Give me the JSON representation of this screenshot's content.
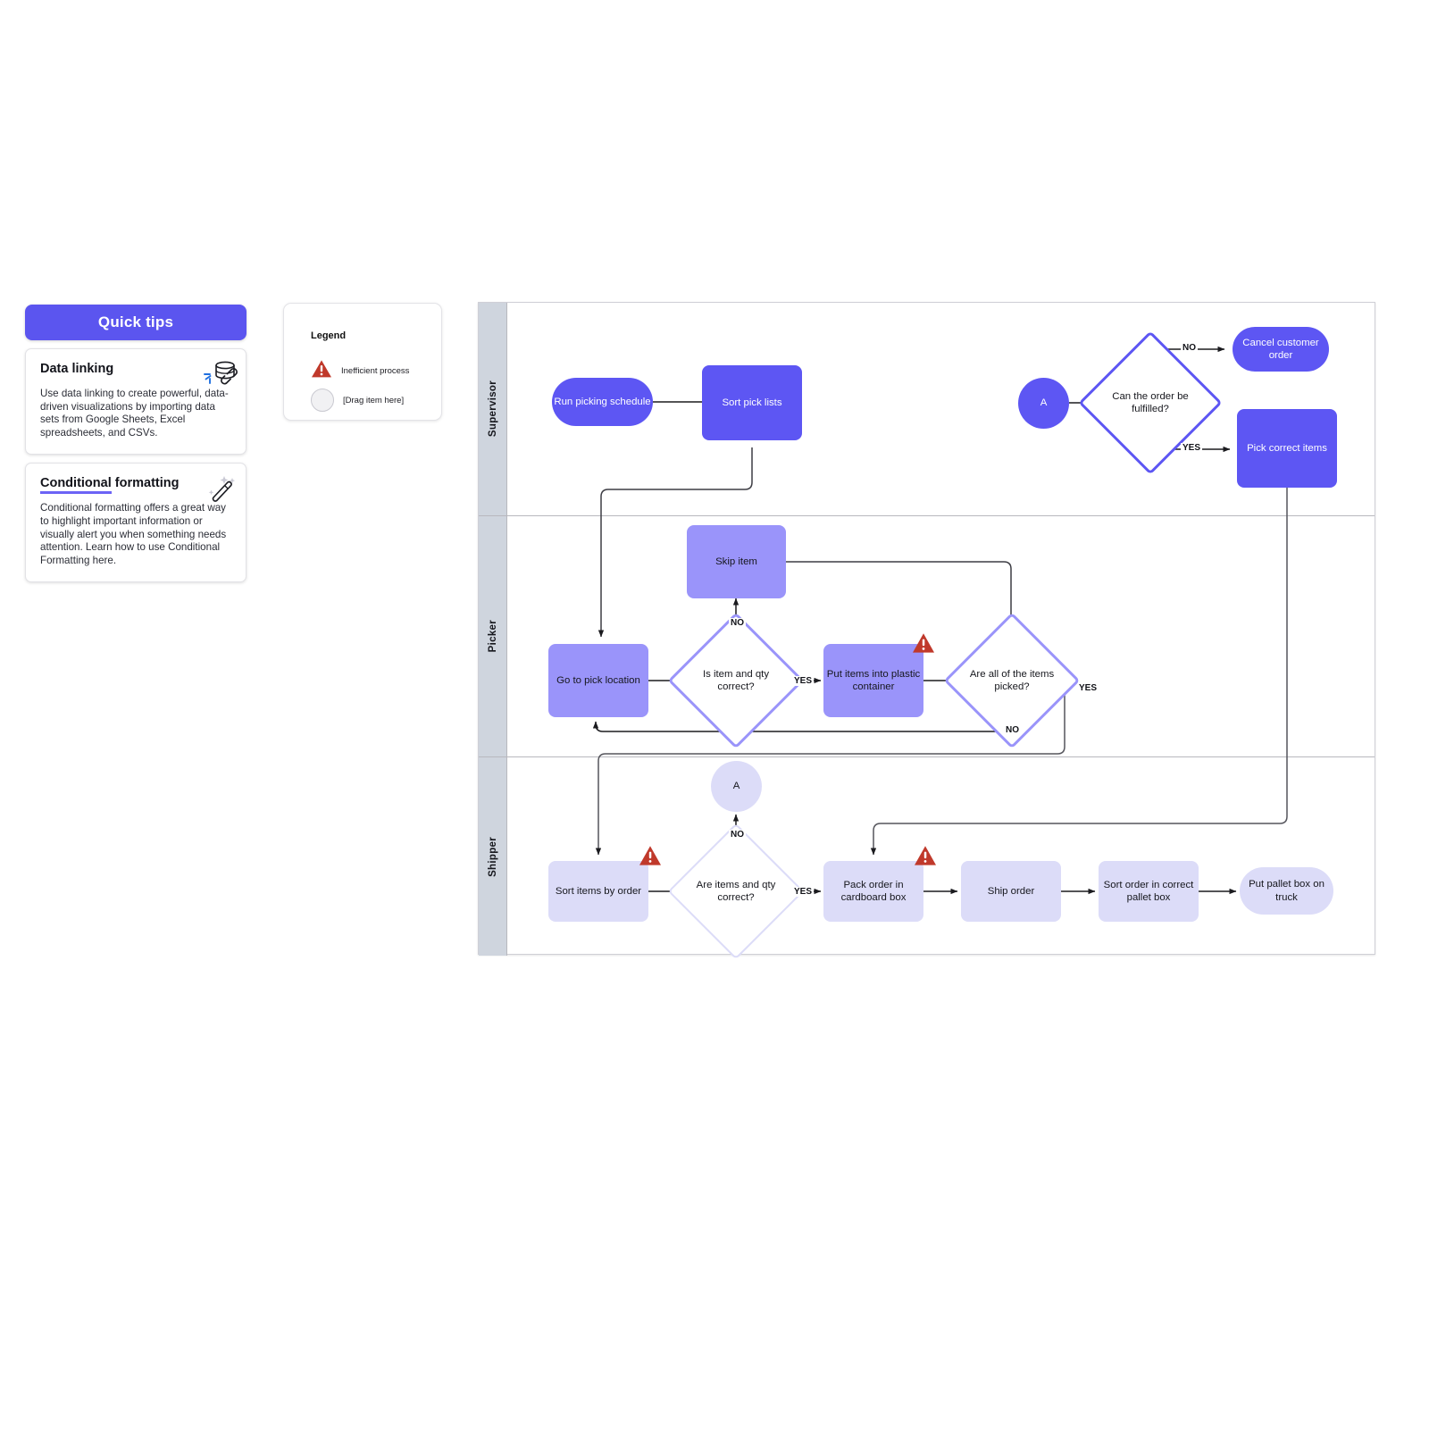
{
  "quick_tips": {
    "header": "Quick tips",
    "cards": [
      {
        "title": "Data linking",
        "title_underline": false,
        "underline_word": "",
        "body": "Use data linking to create powerful, data-driven visualizations by importing data sets from Google Sheets, Excel spreadsheets, and CSVs.",
        "icon": "database-link-icon"
      },
      {
        "title": "Conditional formatting",
        "title_underline": true,
        "underline_word": "Conditional",
        "rest_word": " formatting",
        "body": "Conditional formatting offers a great way to highlight important information or visually alert you when something needs attention. Learn how to use Conditional Formatting here.",
        "icon": "magic-wand-icon"
      }
    ]
  },
  "legend": {
    "title": "Legend",
    "items": [
      {
        "icon": "warning-triangle-icon",
        "label": "Inefficient process"
      },
      {
        "icon": "drop-circle-icon",
        "label": "[Drag item here]"
      }
    ]
  },
  "colors": {
    "supervisor_fill": "#5d56f3",
    "picker_fill": "#9a94fa",
    "shipper_fill": "#dcdcf8",
    "lane_header": "#cfd5de",
    "warning_red": "#c0392b",
    "accent": "#5b55ef"
  },
  "diagram": {
    "type": "swimlane-flowchart",
    "lanes": [
      {
        "id": "supervisor",
        "label": "Supervisor"
      },
      {
        "id": "picker",
        "label": "Picker"
      },
      {
        "id": "shipper",
        "label": "Shipper"
      }
    ],
    "nodes": [
      {
        "id": "run_picking_schedule",
        "lane": "supervisor",
        "shape": "pill",
        "label": "Run picking schedule"
      },
      {
        "id": "sort_pick_lists",
        "lane": "supervisor",
        "shape": "rect",
        "label": "Sort pick lists"
      },
      {
        "id": "connector_a_sup",
        "lane": "supervisor",
        "shape": "circle",
        "label": "A"
      },
      {
        "id": "can_order_be_fulfilled",
        "lane": "supervisor",
        "shape": "diamond",
        "label": "Can the order be fulfilled?"
      },
      {
        "id": "cancel_customer_order",
        "lane": "supervisor",
        "shape": "pill",
        "label": "Cancel customer order"
      },
      {
        "id": "pick_correct_items",
        "lane": "supervisor",
        "shape": "rect",
        "label": "Pick correct items"
      },
      {
        "id": "skip_item",
        "lane": "picker",
        "shape": "rect",
        "label": "Skip item"
      },
      {
        "id": "go_to_pick_location",
        "lane": "picker",
        "shape": "rect",
        "label": "Go to pick location"
      },
      {
        "id": "is_item_and_qty_correct",
        "lane": "picker",
        "shape": "diamond",
        "label": "Is item and qty correct?"
      },
      {
        "id": "put_items_into_plastic_container",
        "lane": "picker",
        "shape": "rect",
        "label": "Put items into plastic container",
        "warning": true
      },
      {
        "id": "are_all_items_picked",
        "lane": "picker",
        "shape": "diamond",
        "label": "Are all of the items picked?"
      },
      {
        "id": "connector_a_ship",
        "lane": "shipper",
        "shape": "circle",
        "label": "A"
      },
      {
        "id": "sort_items_by_order",
        "lane": "shipper",
        "shape": "rect",
        "label": "Sort items by order",
        "warning": true
      },
      {
        "id": "are_items_and_qty_correct",
        "lane": "shipper",
        "shape": "diamond",
        "label": "Are items and qty correct?"
      },
      {
        "id": "pack_order_in_cardboard_box",
        "lane": "shipper",
        "shape": "rect",
        "label": "Pack order in cardboard box",
        "warning": true
      },
      {
        "id": "ship_order",
        "lane": "shipper",
        "shape": "rect",
        "label": "Ship order"
      },
      {
        "id": "sort_order_pallet_box",
        "lane": "shipper",
        "shape": "rect",
        "label": "Sort order in correct pallet box"
      },
      {
        "id": "put_pallet_box_on_truck",
        "lane": "shipper",
        "shape": "pill",
        "label": "Put pallet box on truck"
      }
    ],
    "edges": [
      {
        "from": "run_picking_schedule",
        "to": "sort_pick_lists",
        "label": ""
      },
      {
        "from": "sort_pick_lists",
        "to": "go_to_pick_location",
        "label": ""
      },
      {
        "from": "go_to_pick_location",
        "to": "is_item_and_qty_correct",
        "label": ""
      },
      {
        "from": "is_item_and_qty_correct",
        "to": "skip_item",
        "label": "NO"
      },
      {
        "from": "is_item_and_qty_correct",
        "to": "put_items_into_plastic_container",
        "label": "YES"
      },
      {
        "from": "skip_item",
        "to": "are_all_items_picked",
        "label": ""
      },
      {
        "from": "put_items_into_plastic_container",
        "to": "are_all_items_picked",
        "label": ""
      },
      {
        "from": "are_all_items_picked",
        "to": "go_to_pick_location",
        "label": "NO"
      },
      {
        "from": "are_all_items_picked",
        "to": "sort_items_by_order",
        "label": "YES"
      },
      {
        "from": "sort_items_by_order",
        "to": "are_items_and_qty_correct",
        "label": ""
      },
      {
        "from": "are_items_and_qty_correct",
        "to": "connector_a_ship",
        "label": "NO"
      },
      {
        "from": "are_items_and_qty_correct",
        "to": "pack_order_in_cardboard_box",
        "label": "YES"
      },
      {
        "from": "connector_a_sup",
        "to": "can_order_be_fulfilled",
        "label": ""
      },
      {
        "from": "can_order_be_fulfilled",
        "to": "cancel_customer_order",
        "label": "NO"
      },
      {
        "from": "can_order_be_fulfilled",
        "to": "pick_correct_items",
        "label": "YES"
      },
      {
        "from": "pick_correct_items",
        "to": "pack_order_in_cardboard_box",
        "label": ""
      },
      {
        "from": "pack_order_in_cardboard_box",
        "to": "ship_order",
        "label": ""
      },
      {
        "from": "ship_order",
        "to": "sort_order_pallet_box",
        "label": ""
      },
      {
        "from": "sort_order_pallet_box",
        "to": "put_pallet_box_on_truck",
        "label": ""
      }
    ],
    "edge_labels": {
      "sup_no": "NO",
      "sup_yes": "YES",
      "picker_no_skip": "NO",
      "picker_yes_put": "YES",
      "picker_yes_all": "YES",
      "picker_no_all": "NO",
      "ship_no": "NO",
      "ship_yes": "YES"
    }
  }
}
